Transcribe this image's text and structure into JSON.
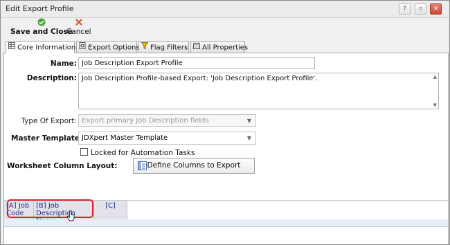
{
  "window": {
    "title": "Edit Export Profile"
  },
  "toolbar": {
    "save_label": "Save and Close",
    "cancel_label": "Cancel",
    "save_icon": "check-circle-icon",
    "cancel_icon": "x-icon"
  },
  "tabs": [
    {
      "label": "Core Information",
      "icon": "table-icon",
      "active": true
    },
    {
      "label": "Export Options",
      "icon": "settings-icon",
      "active": false
    },
    {
      "label": "Flag Filters",
      "icon": "filter-icon",
      "active": false
    },
    {
      "label": "All Properties",
      "icon": "properties-icon",
      "active": false
    }
  ],
  "form": {
    "name_label": "Name:",
    "name_value": "Job Description Export Profile",
    "description_label": "Description:",
    "description_value": "Job Description Profile-based Export: 'Job Description Export Profile'.",
    "type_label": "Type Of Export:",
    "type_value": "Export primary Job Description fields",
    "template_label": "Master Template*:",
    "template_value": "JDXpert Master Template",
    "locked_label": "Locked for Automation Tasks",
    "locked_checked": false,
    "layout_label": "Worksheet Column Layout:",
    "define_button": "Define Columns to Export"
  },
  "grid": {
    "columns": [
      {
        "label": "[A] Job Code"
      },
      {
        "label": "[B] Job Description Name"
      },
      {
        "label": "[C]"
      }
    ]
  },
  "colors": {
    "highlight": "#d8212a",
    "header_text": "#1c2a8c"
  }
}
